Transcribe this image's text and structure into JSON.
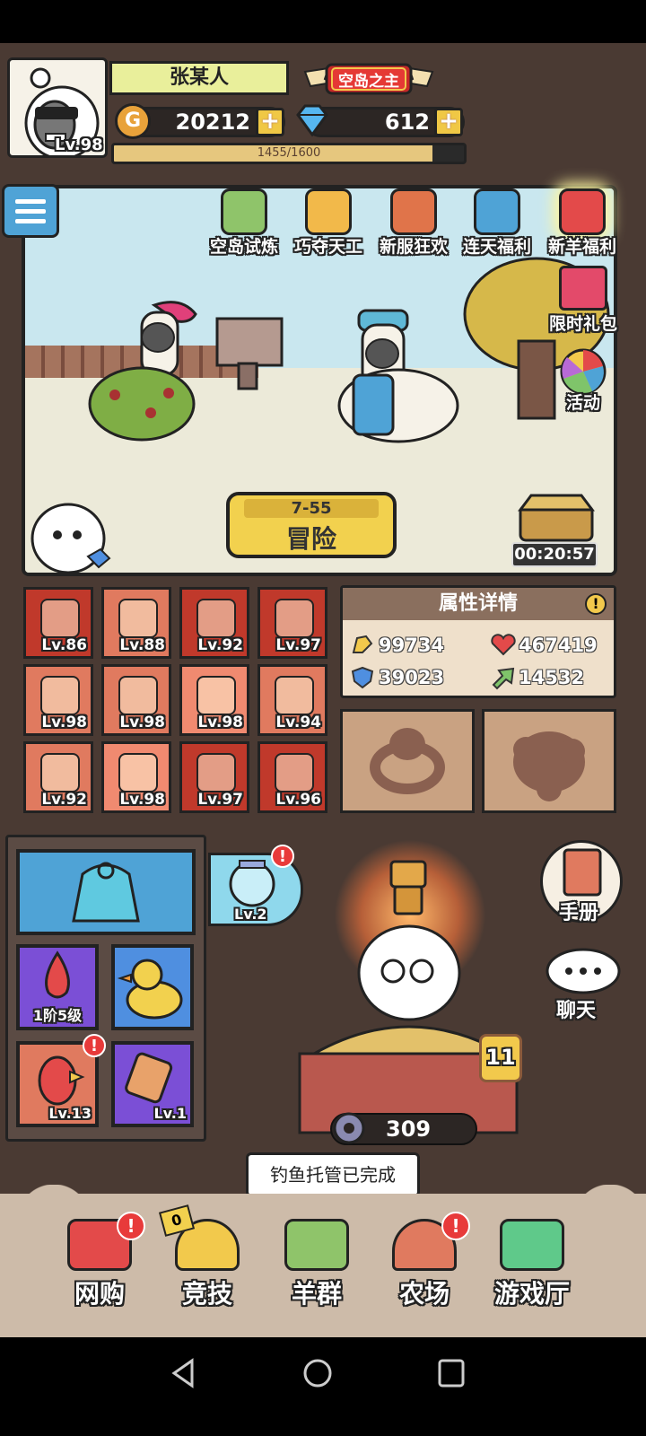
{
  "player": {
    "name": "张某人",
    "level": "Lv.98",
    "title": "空岛之主"
  },
  "currency": {
    "gold": "20212",
    "gems": "612"
  },
  "xp": {
    "text": "1455/1600",
    "fraction": 0.909
  },
  "events": [
    {
      "label": "空岛试炼",
      "icon": "floating-island-icon"
    },
    {
      "label": "巧夺天工",
      "icon": "workshop-icon"
    },
    {
      "label": "新服狂欢",
      "icon": "treasure-chest-icon"
    },
    {
      "label": "连天福利",
      "icon": "gift-box-icon"
    },
    {
      "label": "新羊福利",
      "icon": "lucky-sheep-icon"
    }
  ],
  "side_buttons": {
    "gift_pack": "限时礼包",
    "activity": "活动"
  },
  "adventure": {
    "stage": "7-55",
    "label": "冒险"
  },
  "timer": "00:20:57",
  "equipment": [
    {
      "level": "Lv.86",
      "icon": "hair-icon",
      "color": "#c0392b"
    },
    {
      "level": "Lv.88",
      "icon": "triangle-hat-icon",
      "color": "#e07a5f"
    },
    {
      "level": "Lv.92",
      "icon": "bowl-icon",
      "color": "#c0392b"
    },
    {
      "level": "Lv.97",
      "icon": "fountain-icon",
      "color": "#c0392b"
    },
    {
      "level": "Lv.98",
      "icon": "well-icon",
      "color": "#e07a5f"
    },
    {
      "level": "Lv.98",
      "icon": "haystack-icon",
      "color": "#e07a5f"
    },
    {
      "level": "Lv.98",
      "icon": "flower-icon",
      "color": "#f08a70"
    },
    {
      "level": "Lv.94",
      "icon": "plant-pot-icon",
      "color": "#e07a5f"
    },
    {
      "level": "Lv.92",
      "icon": "cucumber-icon",
      "color": "#e07a5f"
    },
    {
      "level": "Lv.98",
      "icon": "signboard-icon",
      "color": "#f08a70"
    },
    {
      "level": "Lv.97",
      "icon": "wrench-icon",
      "color": "#c0392b"
    },
    {
      "level": "Lv.96",
      "icon": "gate-icon",
      "color": "#c0392b"
    }
  ],
  "attributes": {
    "title": "属性详情",
    "attack": "99734",
    "hp": "467419",
    "defense": "39023",
    "speed": "14532"
  },
  "pets": {
    "fishbowl_level": "Lv.2",
    "egg_stage": "1阶5级",
    "parrot_level": "Lv.13",
    "comb_level": "Lv.1"
  },
  "right_buttons": {
    "handbook": "手册",
    "chat": "聊天"
  },
  "sheep": {
    "level_badge": "11",
    "gear_count": "309"
  },
  "toast": "钓鱼托管已完成",
  "nav": [
    {
      "label": "网购",
      "icon": "shopping-basket-icon",
      "badge": "!"
    },
    {
      "label": "竞技",
      "icon": "trophy-icon",
      "badge": "0"
    },
    {
      "label": "羊群",
      "icon": "flock-icon",
      "badge": ""
    },
    {
      "label": "农场",
      "icon": "barn-icon",
      "badge": "!"
    },
    {
      "label": "游戏厅",
      "icon": "arcade-icon",
      "badge": ""
    }
  ],
  "colors": {
    "gold": "#f2d14e",
    "panel": "#4a3a33",
    "alert": "#e83a3a"
  }
}
